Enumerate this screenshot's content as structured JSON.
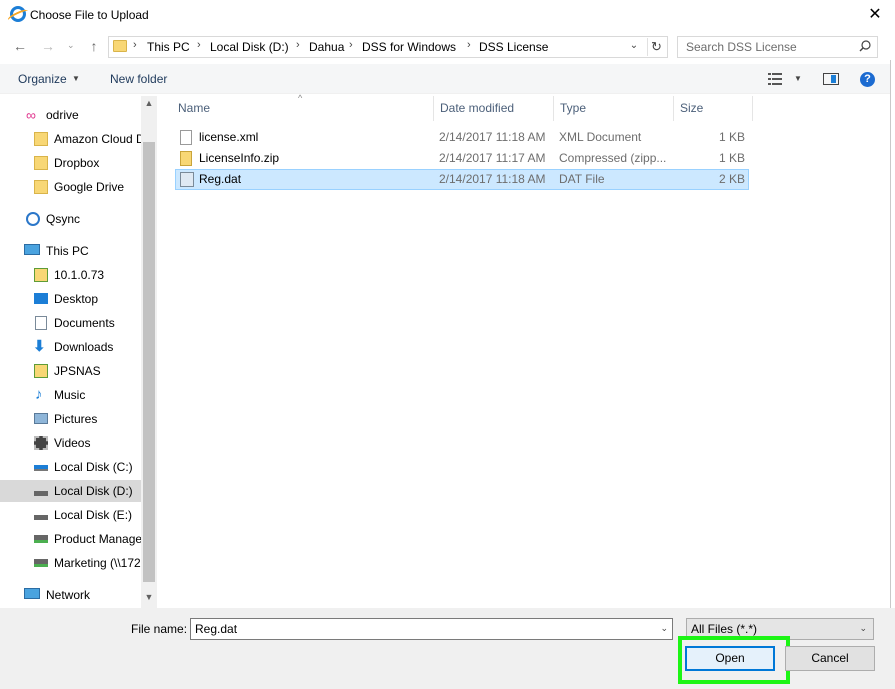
{
  "window": {
    "title": "Choose File to Upload",
    "close_glyph": "✕"
  },
  "address": {
    "crumbs": [
      "This PC",
      "Local Disk (D:)",
      "Dahua",
      "DSS for Windows",
      "DSS License"
    ],
    "separator": "›"
  },
  "search": {
    "placeholder": "Search DSS License"
  },
  "toolbar": {
    "organize_label": "Organize",
    "new_folder_label": "New folder",
    "help_glyph": "?"
  },
  "nav_pane": {
    "items": [
      {
        "label": "odrive",
        "icon": "odrive-icon"
      },
      {
        "label": "Amazon Cloud Drive",
        "icon": "folder-icon"
      },
      {
        "label": "Dropbox",
        "icon": "folder-icon"
      },
      {
        "label": "Google Drive",
        "icon": "folder-icon"
      },
      {
        "label": "Qsync",
        "icon": "qsync-icon"
      },
      {
        "label": "This PC",
        "icon": "computer-icon"
      },
      {
        "label": "10.1.0.73",
        "icon": "network-drive-icon"
      },
      {
        "label": "Desktop",
        "icon": "desktop-icon"
      },
      {
        "label": "Documents",
        "icon": "documents-icon"
      },
      {
        "label": "Downloads",
        "icon": "downloads-icon"
      },
      {
        "label": "JPSNAS",
        "icon": "network-drive-icon"
      },
      {
        "label": "Music",
        "icon": "music-icon"
      },
      {
        "label": "Pictures",
        "icon": "pictures-icon"
      },
      {
        "label": "Videos",
        "icon": "videos-icon"
      },
      {
        "label": "Local Disk (C:)",
        "icon": "windows-drive-icon"
      },
      {
        "label": "Local Disk (D:)",
        "icon": "drive-icon",
        "selected": true
      },
      {
        "label": "Local Disk (E:)",
        "icon": "drive-icon"
      },
      {
        "label": "Product Management",
        "icon": "network-share-icon"
      },
      {
        "label": "Marketing (\\\\172",
        "icon": "network-share-icon"
      },
      {
        "label": "Network",
        "icon": "network-icon"
      }
    ]
  },
  "file_list": {
    "columns": [
      "Name",
      "Date modified",
      "Type",
      "Size"
    ],
    "rows": [
      {
        "name": "license.xml",
        "date": "2/14/2017 11:18 AM",
        "type": "XML Document",
        "size": "1 KB",
        "icon": "xml-file-icon",
        "selected": false
      },
      {
        "name": "LicenseInfo.zip",
        "date": "2/14/2017 11:17 AM",
        "type": "Compressed (zipp...",
        "size": "1 KB",
        "icon": "zip-file-icon",
        "selected": false
      },
      {
        "name": "Reg.dat",
        "date": "2/14/2017 11:18 AM",
        "type": "DAT File",
        "size": "2 KB",
        "icon": "dat-file-icon",
        "selected": true
      }
    ]
  },
  "footer": {
    "filename_label": "File name:",
    "filename_value": "Reg.dat",
    "filetype_value": "All Files (*.*)",
    "open_label": "Open",
    "cancel_label": "Cancel"
  },
  "colors": {
    "accent": "#0078d7",
    "selection": "#cce8ff",
    "highlight": "#1cf515"
  }
}
